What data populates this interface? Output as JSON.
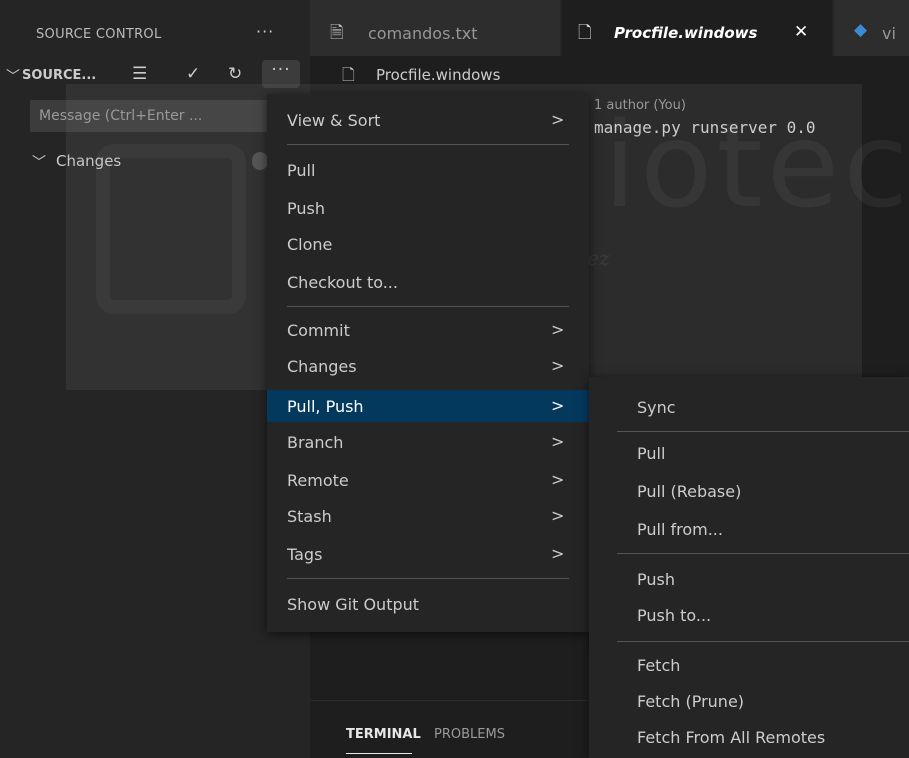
{
  "sidebar": {
    "title": "SOURCE CONTROL",
    "more_glyph": "···",
    "repo": {
      "label": "SOURCE...",
      "icons": [
        "chevron-down-icon",
        "tree-view-icon",
        "checkmark-icon",
        "refresh-icon",
        "more-actions-icon"
      ]
    },
    "message_placeholder": "Message (Ctrl+Enter ...",
    "changes_label": "Changes"
  },
  "tabs": [
    {
      "label": "comandos.txt",
      "icon": "text-file-icon"
    },
    {
      "label": "Procfile.windows",
      "icon": "file-icon",
      "active": true,
      "close_glyph": "✕"
    },
    {
      "label": "vi",
      "icon": "python-icon"
    }
  ],
  "breadcrumb": {
    "label": "Procfile.windows",
    "icon": "file-icon"
  },
  "editor": {
    "codelens": "1 author (You)",
    "code": "manage.py runserver 0.0"
  },
  "panel": {
    "terminal_label": "TERMINAL",
    "problems_label": "PROBLEMS"
  },
  "watermark": {
    "word": "Biblioteca",
    "sub": "UNIVERSITAS Miguel Hernández"
  },
  "main_menu": {
    "view_sort": "View & Sort",
    "pull": "Pull",
    "push": "Push",
    "clone": "Clone",
    "checkout": "Checkout to...",
    "commit": "Commit",
    "changes": "Changes",
    "pull_push": "Pull, Push",
    "branch": "Branch",
    "remote": "Remote",
    "stash": "Stash",
    "tags": "Tags",
    "show_output": "Show Git Output",
    "arrow": ">"
  },
  "sub_menu": {
    "sync": "Sync",
    "pull": "Pull",
    "pull_rebase": "Pull (Rebase)",
    "pull_from": "Pull from...",
    "push": "Push",
    "push_to": "Push to...",
    "fetch": "Fetch",
    "fetch_prune": "Fetch (Prune)",
    "fetch_all": "Fetch From All Remotes"
  },
  "colors": {
    "selected_item": "#04395e",
    "sidebar_bg": "#252526",
    "editor_bg": "#1e1e1e",
    "python_icon": "#3b8bd3"
  }
}
